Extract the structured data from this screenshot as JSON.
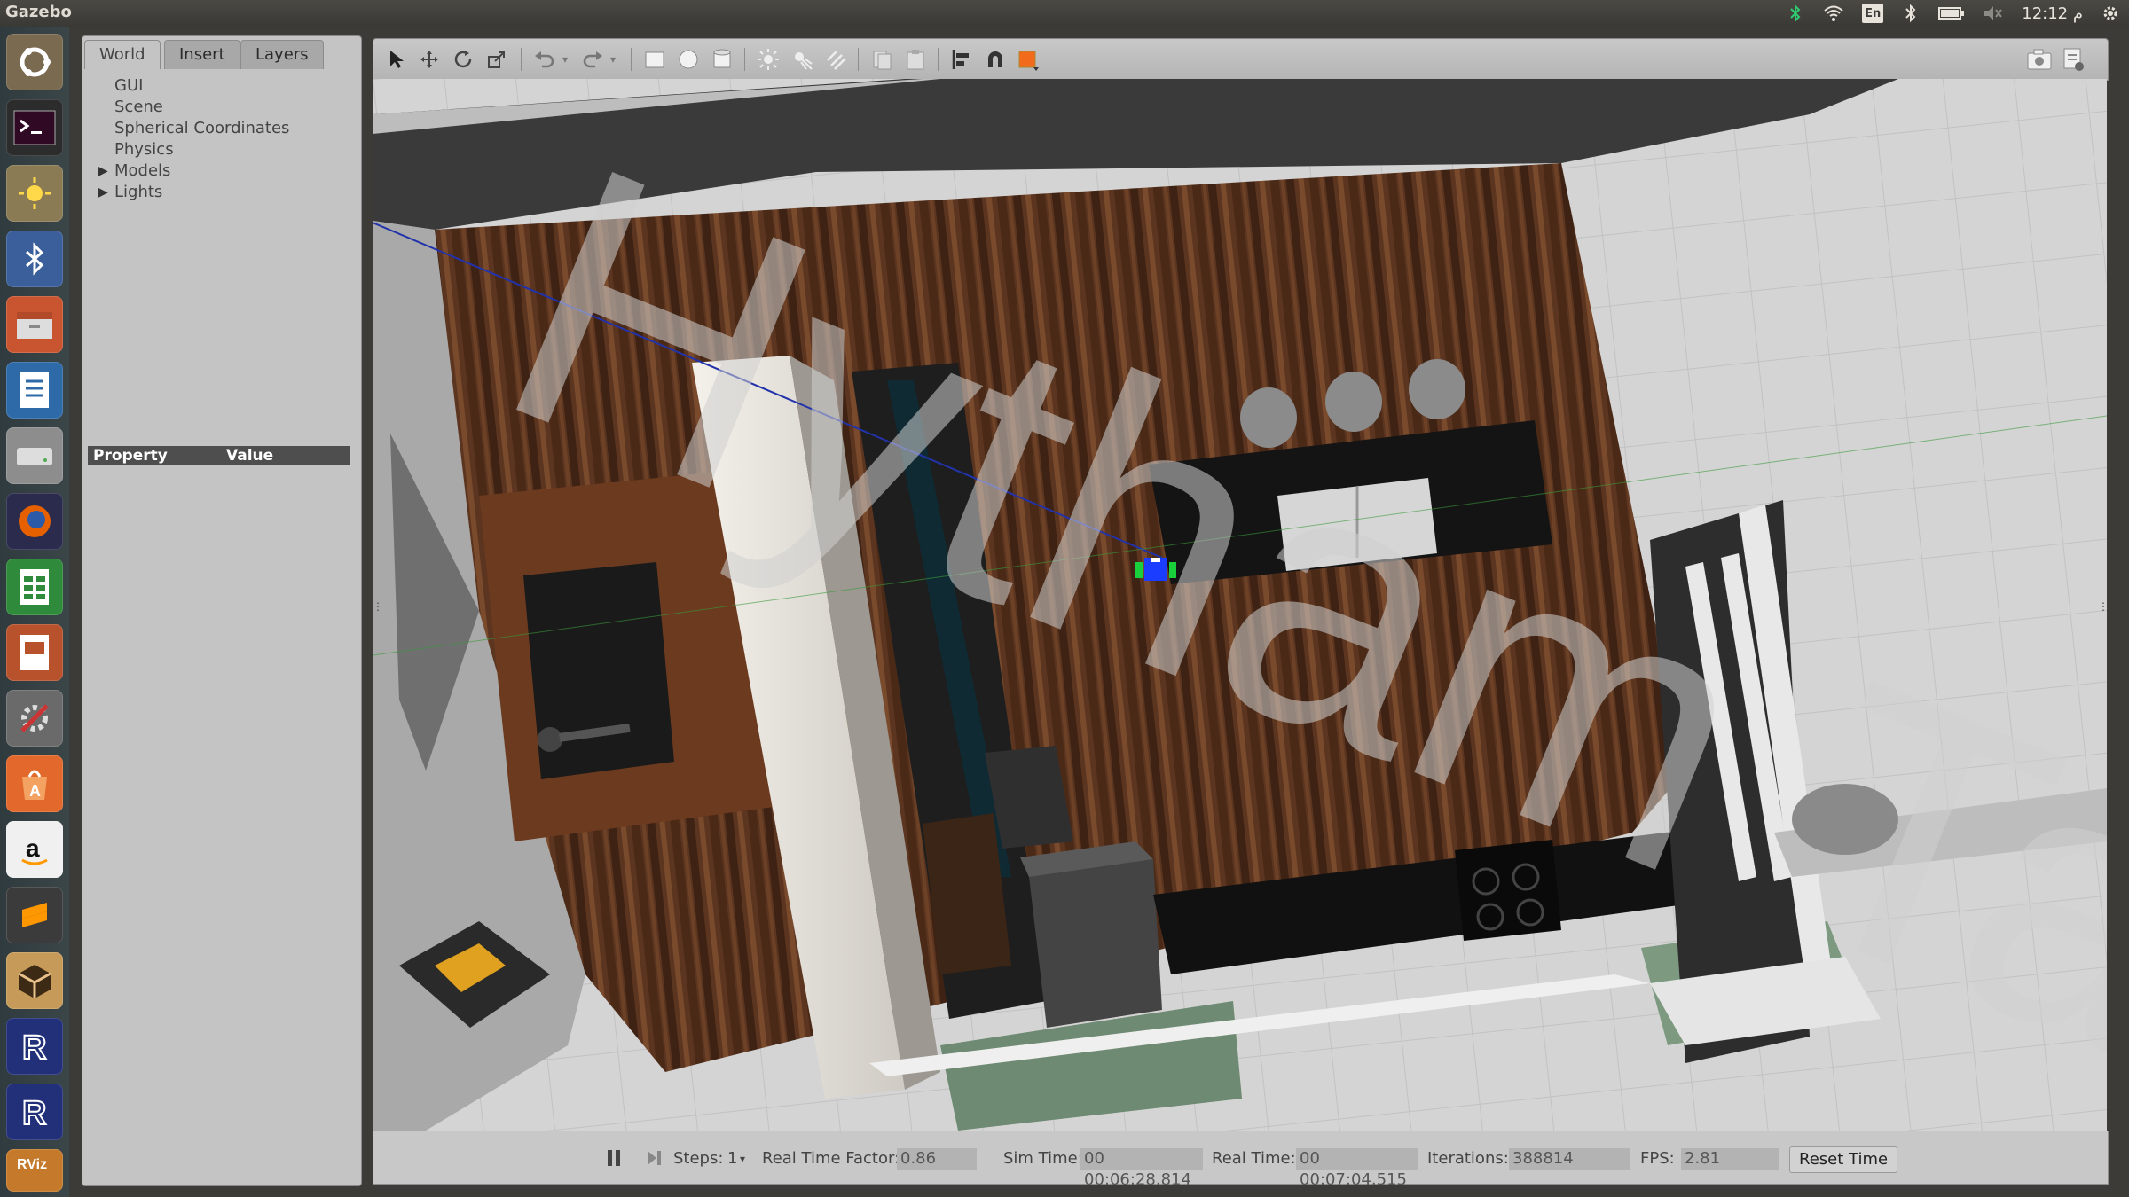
{
  "topbar": {
    "app_title": "Gazebo",
    "keyboard_layout": "En",
    "clock": " م 12:12",
    "icons": [
      "bluetooth-icon",
      "wifi-icon",
      "keyboard-icon",
      "bluetooth-status-icon",
      "battery-icon",
      "volume-icon",
      "gear-icon"
    ]
  },
  "launcher": {
    "items": [
      "ubuntu-dash",
      "terminal",
      "system-settings",
      "bluetooth",
      "files",
      "writer",
      "disk",
      "firefox",
      "calc",
      "impress",
      "tools",
      "software-center",
      "amazon",
      "sublime",
      "box",
      "rviz-a",
      "rviz-b",
      "rviz-c"
    ]
  },
  "left_panel": {
    "tabs": [
      "World",
      "Insert",
      "Layers"
    ],
    "tree": [
      "GUI",
      "Scene",
      "Spherical Coordinates",
      "Physics",
      "Models",
      "Lights"
    ],
    "property_header": {
      "property": "Property",
      "value": "Value"
    }
  },
  "watermark": "Hytham Tag",
  "status": {
    "steps_label": "Steps:",
    "steps_value": "1",
    "rtf_label": "Real Time Factor:",
    "rtf_value": "0.86",
    "sim_time_label": "Sim Time:",
    "sim_time_value": "00 00:06:28.814",
    "real_time_label": "Real Time:",
    "real_time_value": "00 00:07:04.515",
    "iterations_label": "Iterations:",
    "iterations_value": "388814",
    "fps_label": "FPS:",
    "fps_value": "2.81",
    "reset_label": "Reset Time"
  },
  "colors": {
    "floor_wood": "#5a341c",
    "countertop": "#151515",
    "wall_white": "#e6e2db",
    "ground_tiles": "#d3d3d3",
    "robot": "#1a3dff"
  }
}
